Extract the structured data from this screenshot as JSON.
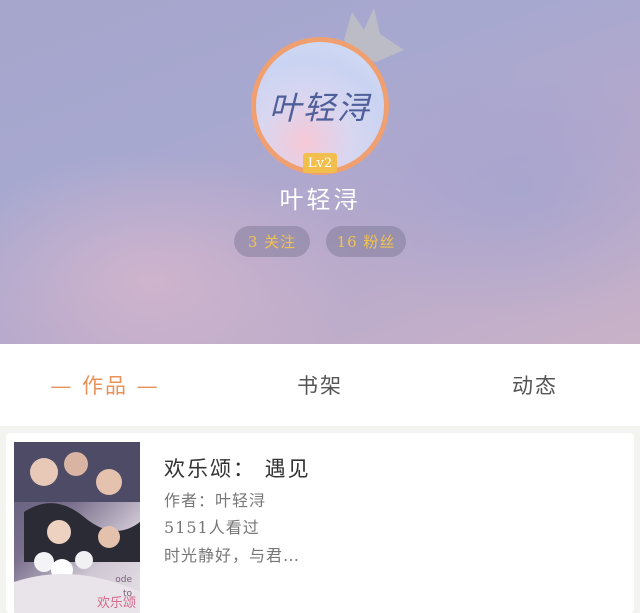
{
  "profile": {
    "avatar_text": "叶轻浔",
    "level": "Lv2",
    "username": "叶轻浔",
    "following": "3 关注",
    "fans": "16 粉丝"
  },
  "tabs": {
    "works": "— 作品 —",
    "shelf": "书架",
    "feed": "动态"
  },
  "book": {
    "title": "欢乐颂： 遇见",
    "author": "作者：叶轻浔",
    "views": "5151人看过",
    "description": "时光静好，与君…",
    "cover_text": "欢乐颂"
  },
  "colors": {
    "accent": "#e8925a",
    "badge": "#f2bf4e",
    "stat_text": "#f2c24f"
  }
}
